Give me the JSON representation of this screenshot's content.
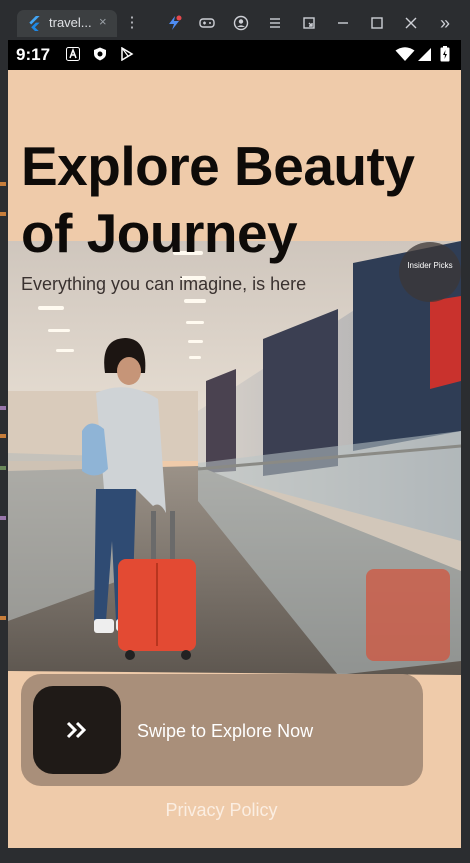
{
  "ide": {
    "tab_label": "travel...",
    "tab_close": "×",
    "more_actions": "⋮",
    "overflow": "»"
  },
  "status_bar": {
    "time": "9:17",
    "notification_icons": [
      "a-icon",
      "shield-icon",
      "play-store-icon"
    ],
    "right_icons": [
      "wifi-icon",
      "signal-icon",
      "battery-icon"
    ]
  },
  "app": {
    "headline_line1": "Explore Beauty",
    "headline_line2": "of Journey",
    "subtitle": "Everything you can imagine, is here",
    "badge": "Insider Picks",
    "swipe_label": "Swipe to Explore Now",
    "privacy_link": "Privacy Policy",
    "colors": {
      "background": "#efcbaa",
      "swipe_track": "#a98f7a",
      "swipe_button": "#1f1a17",
      "headline": "#0e0b09"
    }
  }
}
